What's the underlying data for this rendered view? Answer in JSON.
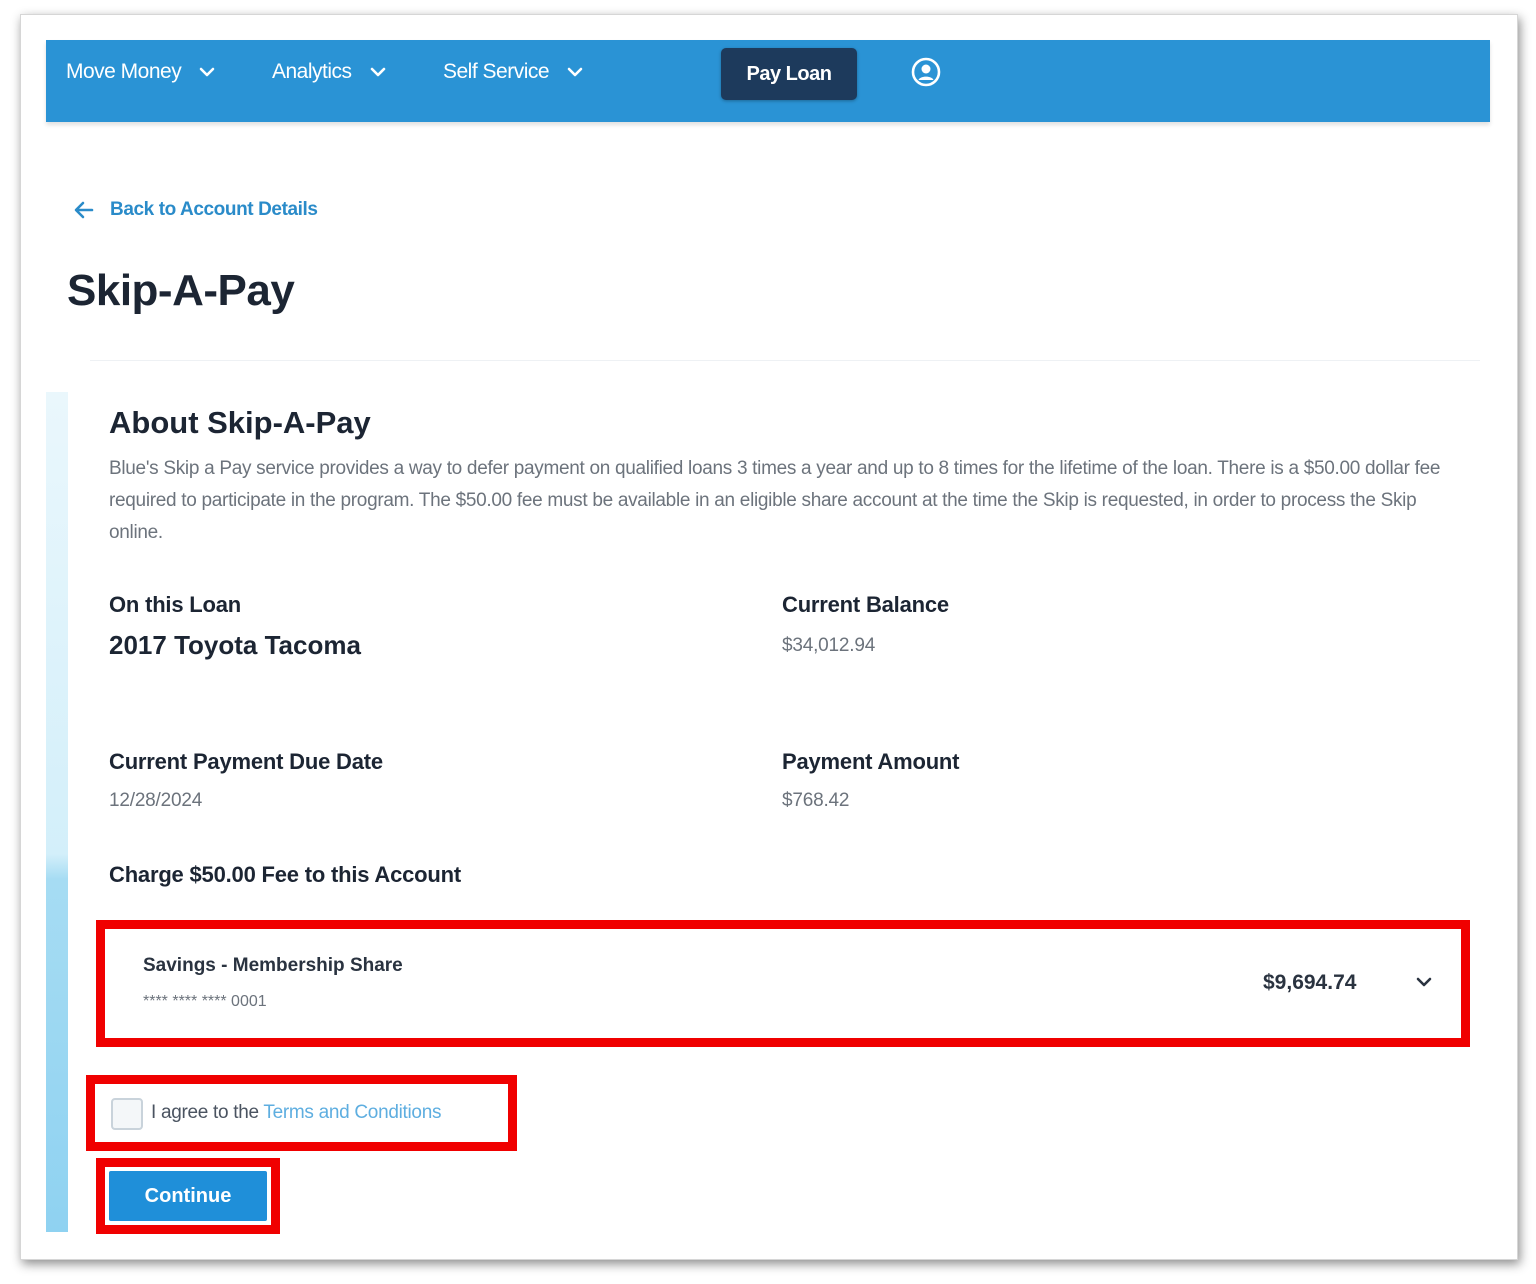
{
  "nav": {
    "items": [
      {
        "label": "Move Money"
      },
      {
        "label": "Analytics"
      },
      {
        "label": "Self Service"
      }
    ],
    "pay_loan_label": "Pay Loan"
  },
  "back_link": "Back to Account Details",
  "page_title": "Skip-A-Pay",
  "about": {
    "title": "About Skip-A-Pay",
    "body": "Blue's Skip a Pay service provides a way to defer payment on qualified loans 3 times a year and up to 8 times for the lifetime of the loan. There is a $50.00 dollar fee required to participate in the program. The $50.00 fee must be available in an eligible share account at the time the Skip is requested, in order to process the Skip online."
  },
  "loan": {
    "label": "On this Loan",
    "name": "2017 Toyota Tacoma",
    "balance_label": "Current Balance",
    "balance": "$34,012.94",
    "due_label": "Current Payment Due Date",
    "due_date": "12/28/2024",
    "payment_label": "Payment Amount",
    "payment_amount": "$768.42"
  },
  "fee_account": {
    "label": "Charge $50.00 Fee to this Account",
    "account_name": "Savings - Membership Share",
    "account_number": "**** **** **** 0001",
    "account_balance": "$9,694.74"
  },
  "agree": {
    "prefix": "I agree to the ",
    "link": "Terms and Conditions",
    "checked": false
  },
  "continue_label": "Continue",
  "colors": {
    "nav_bg": "#2a93d5",
    "pay_loan_bg": "#1d3a5c",
    "link": "#2a8bc9",
    "highlight": "#f00000",
    "button": "#1f8fd9"
  }
}
